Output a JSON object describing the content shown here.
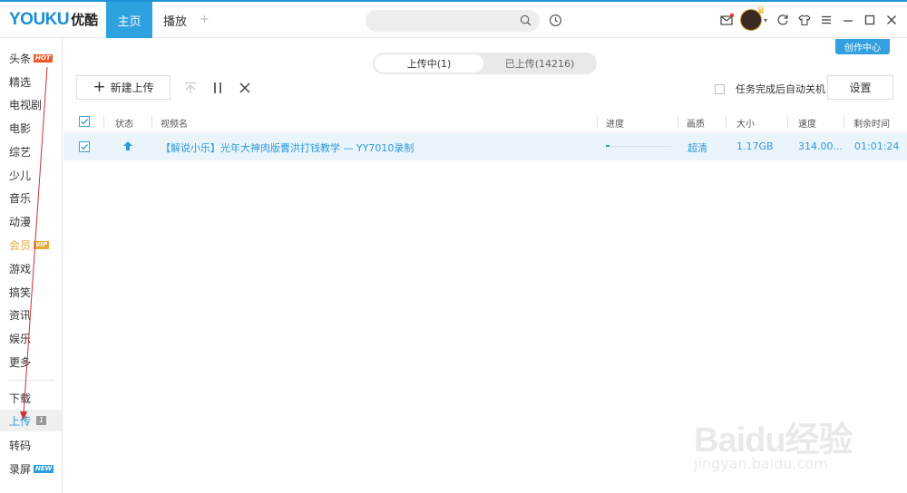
{
  "topbar": {
    "logo_latin": "YOUKU",
    "logo_cn": "优酷",
    "tabs": [
      {
        "label": "主页",
        "active": true
      },
      {
        "label": "播放",
        "active": false
      }
    ],
    "add_tab": "+",
    "search": {
      "placeholder": "",
      "value": ""
    },
    "creator_center": "创作中心"
  },
  "sidebar": {
    "items": [
      {
        "label": "头条",
        "badge": "HOT"
      },
      {
        "label": "精选"
      },
      {
        "label": "电视剧"
      },
      {
        "label": "电影"
      },
      {
        "label": "综艺"
      },
      {
        "label": "少儿"
      },
      {
        "label": "音乐"
      },
      {
        "label": "动漫"
      },
      {
        "label": "会员",
        "badge": "VIP"
      },
      {
        "label": "游戏"
      },
      {
        "label": "搞笑"
      },
      {
        "label": "资讯"
      },
      {
        "label": "娱乐"
      },
      {
        "label": "更多"
      }
    ],
    "bottom_items": [
      {
        "label": "下载"
      },
      {
        "label": "上传",
        "count": "1",
        "active": true
      },
      {
        "label": "转码"
      },
      {
        "label": "录屏",
        "badge": "NEW"
      }
    ]
  },
  "upload": {
    "switch": {
      "uploading": "上传中(1)",
      "uploaded": "已上传(14216)"
    },
    "toolbar": {
      "new_upload": "新建上传",
      "auto_shutdown": "任务完成后自动关机",
      "settings": "设置"
    },
    "table": {
      "headers": [
        "状态",
        "视频名",
        "进度",
        "画质",
        "大小",
        "速度",
        "剩余时间"
      ],
      "rows": [
        {
          "checked": true,
          "status": "uploading",
          "name": "【解说小乐】光年大神肉版曹洪打钱教学 — YY7010录制",
          "progress": 0.05,
          "quality": "超清",
          "size": "1.17GB",
          "speed": "314.00...",
          "remaining": "01:01:24"
        }
      ]
    }
  },
  "watermark": {
    "main": "Baidu经验",
    "sub": "jingyan.baidu.com"
  },
  "colors": {
    "accent": "#2ea2de",
    "brand_red": "#ef3a3a",
    "hot": "#f25a2c",
    "vip": "#e9a93b",
    "row_highlight": "#eaf5fb"
  }
}
